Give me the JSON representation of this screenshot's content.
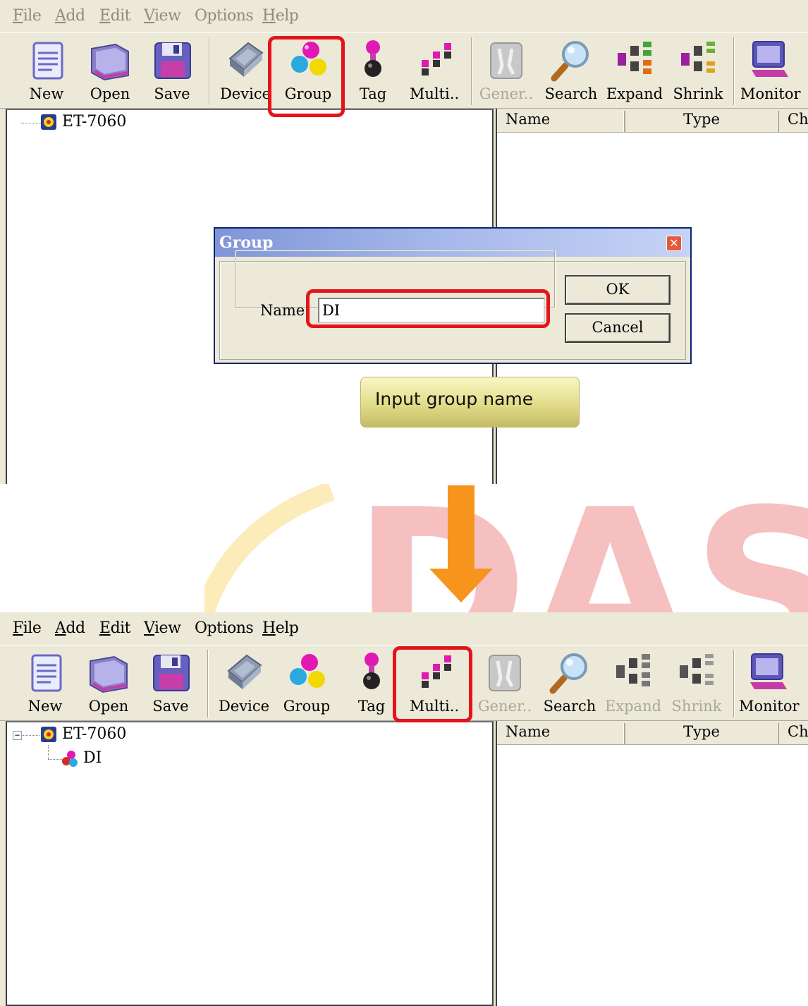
{
  "top": {
    "menu": [
      {
        "underline": "F",
        "rest": "ile",
        "name": "menu-file"
      },
      {
        "underline": "A",
        "rest": "dd",
        "name": "menu-add"
      },
      {
        "underline": "E",
        "rest": "dit",
        "name": "menu-edit"
      },
      {
        "underline": "V",
        "rest": "iew",
        "name": "menu-view"
      },
      {
        "underline": "",
        "rest": "Options",
        "name": "menu-options"
      },
      {
        "underline": "H",
        "rest": "elp",
        "name": "menu-help"
      }
    ],
    "toolbar": [
      "New",
      "Open",
      "Save",
      "Device",
      "Group",
      "Tag",
      "Multi..",
      "Gener..",
      "Search",
      "Expand",
      "Shrink",
      "Monitor"
    ],
    "tree_root": "ET-7060",
    "list_columns": [
      "Name",
      "Type",
      "Ch"
    ],
    "dialog": {
      "title": "Group",
      "name_label": "Name",
      "name_value": "DI",
      "ok_label": "OK",
      "cancel_label": "Cancel",
      "close_symbol": "✕"
    },
    "callout": "Input group name"
  },
  "watermark_text": "DAS",
  "bottom": {
    "menu": [
      {
        "underline": "F",
        "rest": "ile"
      },
      {
        "underline": "A",
        "rest": "dd"
      },
      {
        "underline": "E",
        "rest": "dit"
      },
      {
        "underline": "V",
        "rest": "iew"
      },
      {
        "underline": "",
        "rest": "Options"
      },
      {
        "underline": "H",
        "rest": "elp"
      }
    ],
    "toolbar": [
      "New",
      "Open",
      "Save",
      "Device",
      "Group",
      "Tag",
      "Multi..",
      "Gener..",
      "Search",
      "Expand",
      "Shrink",
      "Monitor"
    ],
    "tree_root": "ET-7060",
    "tree_child": "DI",
    "list_columns": [
      "Name",
      "Type",
      "Ch"
    ]
  },
  "colors": {
    "highlight": "#e5141b",
    "arrow": "#f7941d",
    "watermark_red": "#f5b3b3",
    "watermark_yellow": "#fbe7a8"
  }
}
